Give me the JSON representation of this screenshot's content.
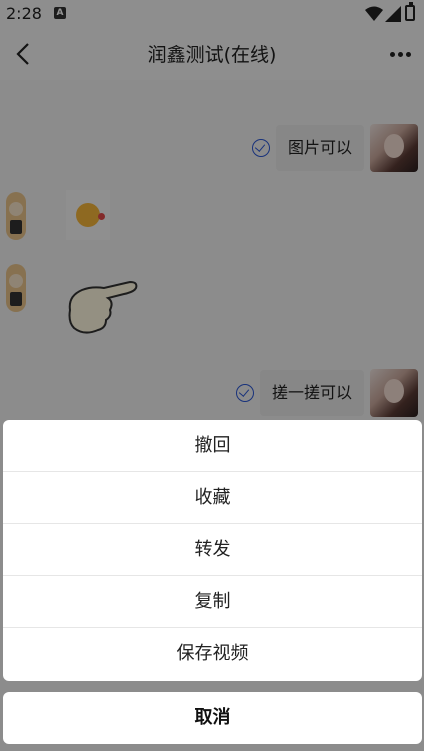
{
  "status_bar": {
    "time": "2:28",
    "notification_icon": "A"
  },
  "nav": {
    "title": "润鑫测试(在线)"
  },
  "chat": {
    "messages": [
      {
        "side": "right",
        "text": "图片可以"
      },
      {
        "side": "left",
        "type": "sticker",
        "sticker": "kiss-emoji"
      },
      {
        "side": "left",
        "type": "sticker",
        "sticker": "pointing-hand"
      },
      {
        "side": "right",
        "text": "搓一搓可以"
      }
    ]
  },
  "sheet": {
    "items": [
      "撤回",
      "收藏",
      "转发",
      "复制",
      "保存视频"
    ],
    "cancel": "取消"
  },
  "colors": {
    "accent": "#2a56d4",
    "overlay": "rgba(0,0,0,0.42)"
  }
}
